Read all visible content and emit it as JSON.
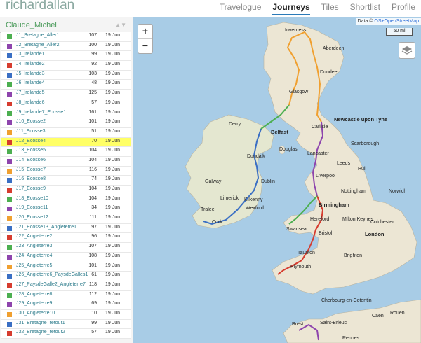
{
  "app": {
    "brand": "richardallan"
  },
  "nav": [
    {
      "label": "Travelogue",
      "active": false
    },
    {
      "label": "Journeys",
      "active": true
    },
    {
      "label": "Tiles",
      "active": false
    },
    {
      "label": "Shortlist",
      "active": false
    },
    {
      "label": "Profile",
      "active": false
    }
  ],
  "sidebar": {
    "title": "Claude_Michel",
    "sort_icon": "▲▼",
    "rows": [
      {
        "name": "J1_Bretagne_Aller1",
        "dist": "107",
        "date": "19 Jun",
        "color": "#4caf50"
      },
      {
        "name": "J2_Bretagne_Aller2",
        "dist": "100",
        "date": "19 Jun",
        "color": "#8e44ad"
      },
      {
        "name": "J3_Irelande1",
        "dist": "99",
        "date": "19 Jun",
        "color": "#3a6fc4"
      },
      {
        "name": "J4_Irelande2",
        "dist": "92",
        "date": "19 Jun",
        "color": "#d63c2f"
      },
      {
        "name": "J5_Irelande3",
        "dist": "103",
        "date": "19 Jun",
        "color": "#3a6fc4"
      },
      {
        "name": "J6_Irelande4",
        "dist": "48",
        "date": "19 Jun",
        "color": "#4caf50"
      },
      {
        "name": "J7_Irelande5",
        "dist": "125",
        "date": "19 Jun",
        "color": "#8e44ad"
      },
      {
        "name": "J8_Irelande6",
        "dist": "57",
        "date": "19 Jun",
        "color": "#d63c2f"
      },
      {
        "name": "J9_Irelande7_Ecosse1",
        "dist": "161",
        "date": "19 Jun",
        "color": "#4caf50"
      },
      {
        "name": "J10_Ecosse2",
        "dist": "101",
        "date": "19 Jun",
        "color": "#8e44ad"
      },
      {
        "name": "J11_Ecosse3",
        "dist": "51",
        "date": "19 Jun",
        "color": "#f0a030"
      },
      {
        "name": "J12_Ecosse4",
        "dist": "70",
        "date": "19 Jun",
        "color": "#d63c2f",
        "highlight": true
      },
      {
        "name": "J13_Ecosse5",
        "dist": "104",
        "date": "19 Jun",
        "color": "#4caf50"
      },
      {
        "name": "J14_Ecosse6",
        "dist": "104",
        "date": "19 Jun",
        "color": "#8e44ad"
      },
      {
        "name": "J15_Ecosse7",
        "dist": "116",
        "date": "19 Jun",
        "color": "#f0a030"
      },
      {
        "name": "J16_Ecosse8",
        "dist": "74",
        "date": "19 Jun",
        "color": "#3a6fc4"
      },
      {
        "name": "J17_Ecosse9",
        "dist": "104",
        "date": "19 Jun",
        "color": "#d63c2f"
      },
      {
        "name": "J18_Ecosse10",
        "dist": "104",
        "date": "19 Jun",
        "color": "#4caf50"
      },
      {
        "name": "J19_Ecosse11",
        "dist": "34",
        "date": "19 Jun",
        "color": "#8e44ad"
      },
      {
        "name": "J20_Ecosse12",
        "dist": "111",
        "date": "19 Jun",
        "color": "#f0a030"
      },
      {
        "name": "J21_Ecosse13_Angleterre1",
        "dist": "97",
        "date": "19 Jun",
        "color": "#3a6fc4"
      },
      {
        "name": "J22_Angleterre2",
        "dist": "96",
        "date": "19 Jun",
        "color": "#d63c2f"
      },
      {
        "name": "J23_Angleterre3",
        "dist": "107",
        "date": "19 Jun",
        "color": "#4caf50"
      },
      {
        "name": "J24_Angleterre4",
        "dist": "108",
        "date": "19 Jun",
        "color": "#8e44ad"
      },
      {
        "name": "J25_Angleterre5",
        "dist": "101",
        "date": "19 Jun",
        "color": "#f0a030"
      },
      {
        "name": "J26_Angleterre6_PaysdeGalles1",
        "dist": "61",
        "date": "19 Jun",
        "color": "#3a6fc4"
      },
      {
        "name": "J27_PaysdeGalle2_Angleterre7",
        "dist": "118",
        "date": "19 Jun",
        "color": "#d63c2f"
      },
      {
        "name": "J28_Angleterre8",
        "dist": "112",
        "date": "19 Jun",
        "color": "#4caf50"
      },
      {
        "name": "J29_Angleterre9",
        "dist": "69",
        "date": "19 Jun",
        "color": "#8e44ad"
      },
      {
        "name": "J30_Angleterre10",
        "dist": "10",
        "date": "19 Jun",
        "color": "#f0a030"
      },
      {
        "name": "J31_Bretagne_retour1",
        "dist": "99",
        "date": "19 Jun",
        "color": "#3a6fc4"
      },
      {
        "name": "J32_Bretagne_retour2",
        "dist": "57",
        "date": "19 Jun",
        "color": "#d63c2f"
      }
    ]
  },
  "map": {
    "zoom_in": "+",
    "zoom_out": "−",
    "attribution_prefix": "Data ©",
    "attribution_link": "OS+OpenStreetMap",
    "scale_label": "50 mi",
    "layers_icon": "layers-icon",
    "places": [
      {
        "name": "Inverness",
        "big": false
      },
      {
        "name": "Aberdeen",
        "big": false
      },
      {
        "name": "Dundee",
        "big": false
      },
      {
        "name": "Glasgow",
        "big": false
      },
      {
        "name": "Derry",
        "big": false
      },
      {
        "name": "Newcastle upon Tyne",
        "big": true
      },
      {
        "name": "Belfast",
        "big": true
      },
      {
        "name": "Carlisle",
        "big": false
      },
      {
        "name": "Scarborough",
        "big": false
      },
      {
        "name": "Douglas",
        "big": false
      },
      {
        "name": "Dundalk",
        "big": false
      },
      {
        "name": "Lancaster",
        "big": false
      },
      {
        "name": "Leeds",
        "big": false
      },
      {
        "name": "Hull",
        "big": false
      },
      {
        "name": "Galway",
        "big": false
      },
      {
        "name": "Dublin",
        "big": false
      },
      {
        "name": "Liverpool",
        "big": false
      },
      {
        "name": "Nottingham",
        "big": false
      },
      {
        "name": "Norwich",
        "big": false
      },
      {
        "name": "Limerick",
        "big": false
      },
      {
        "name": "Kilkenny",
        "big": false
      },
      {
        "name": "Birmingham",
        "big": true
      },
      {
        "name": "Tralee",
        "big": false
      },
      {
        "name": "Wexford",
        "big": false
      },
      {
        "name": "Milton Keynes",
        "big": false
      },
      {
        "name": "Hereford",
        "big": false
      },
      {
        "name": "Colchester",
        "big": false
      },
      {
        "name": "Cork",
        "big": false
      },
      {
        "name": "Swansea",
        "big": false
      },
      {
        "name": "Bristol",
        "big": false
      },
      {
        "name": "London",
        "big": true
      },
      {
        "name": "Taunton",
        "big": false
      },
      {
        "name": "Brighton",
        "big": false
      },
      {
        "name": "Plymouth",
        "big": false
      },
      {
        "name": "Cherbourg-en-Cotentin",
        "big": false
      },
      {
        "name": "Caen",
        "big": false
      },
      {
        "name": "Brest",
        "big": false
      },
      {
        "name": "Saint-Brieuc",
        "big": false
      },
      {
        "name": "Rouen",
        "big": false
      },
      {
        "name": "Rennes",
        "big": false
      }
    ]
  },
  "colors": {
    "accent": "#2a7ab8",
    "highlight": "#ffff66",
    "sea": "#a8cce6",
    "land": "#e9e4d6"
  }
}
